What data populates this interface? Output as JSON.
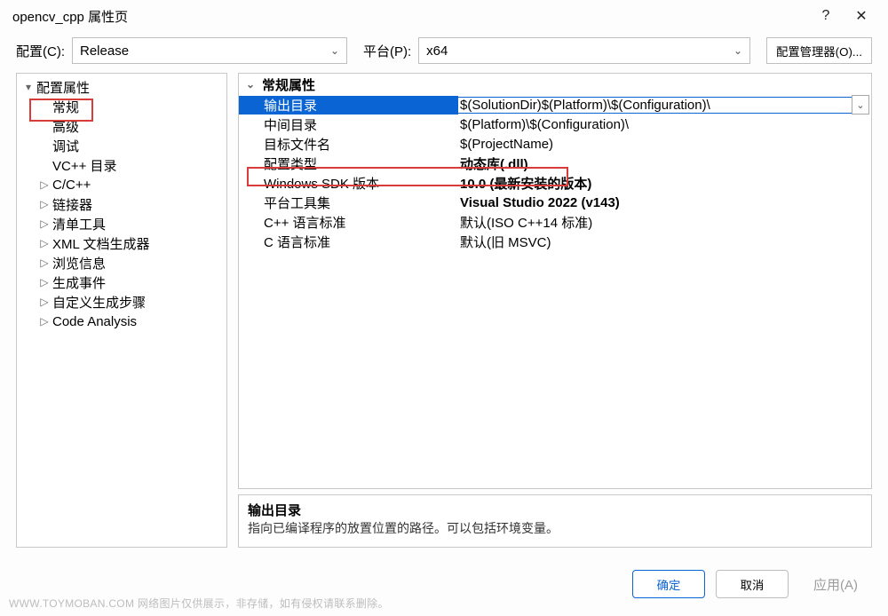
{
  "titlebar": {
    "title": "opencv_cpp 属性页",
    "help": "?",
    "close": "✕"
  },
  "toprow": {
    "config_label": "配置(C):",
    "config_value": "Release",
    "platform_label": "平台(P):",
    "platform_value": "x64",
    "manager_label": "配置管理器(O)..."
  },
  "tree": {
    "root": "配置属性",
    "items": [
      {
        "label": "常规",
        "depth": 1,
        "expandable": false,
        "selected": true
      },
      {
        "label": "高级",
        "depth": 1,
        "expandable": false
      },
      {
        "label": "调试",
        "depth": 1,
        "expandable": false
      },
      {
        "label": "VC++ 目录",
        "depth": 1,
        "expandable": false
      },
      {
        "label": "C/C++",
        "depth": 1,
        "expandable": true
      },
      {
        "label": "链接器",
        "depth": 1,
        "expandable": true
      },
      {
        "label": "清单工具",
        "depth": 1,
        "expandable": true
      },
      {
        "label": "XML 文档生成器",
        "depth": 1,
        "expandable": true
      },
      {
        "label": "浏览信息",
        "depth": 1,
        "expandable": true
      },
      {
        "label": "生成事件",
        "depth": 1,
        "expandable": true
      },
      {
        "label": "自定义生成步骤",
        "depth": 1,
        "expandable": true
      },
      {
        "label": "Code Analysis",
        "depth": 1,
        "expandable": true
      }
    ]
  },
  "grid": {
    "header": "常规属性",
    "rows": [
      {
        "name": "输出目录",
        "value": "$(SolutionDir)$(Platform)\\$(Configuration)\\",
        "selected": true
      },
      {
        "name": "中间目录",
        "value": "$(Platform)\\$(Configuration)\\"
      },
      {
        "name": "目标文件名",
        "value": "$(ProjectName)"
      },
      {
        "name": "配置类型",
        "value": "动态库(.dll)",
        "bold": true
      },
      {
        "name": "Windows SDK 版本",
        "value": "10.0 (最新安装的版本)",
        "bold": true
      },
      {
        "name": "平台工具集",
        "value": "Visual Studio 2022 (v143)",
        "bold": true
      },
      {
        "name": "C++ 语言标准",
        "value": "默认(ISO C++14 标准)"
      },
      {
        "name": "C 语言标准",
        "value": "默认(旧 MSVC)"
      }
    ]
  },
  "desc": {
    "title": "输出目录",
    "text": "指向已编译程序的放置位置的路径。可以包括环境变量。"
  },
  "footer": {
    "ok": "确定",
    "cancel": "取消",
    "apply": "应用(A)"
  },
  "watermark": "WWW.TOYMOBAN.COM  网络图片仅供展示，非存储，如有侵权请联系删除。",
  "glyphs": {
    "caret_down": "▾",
    "caret_right": "▷",
    "chev_down": "⌄"
  }
}
